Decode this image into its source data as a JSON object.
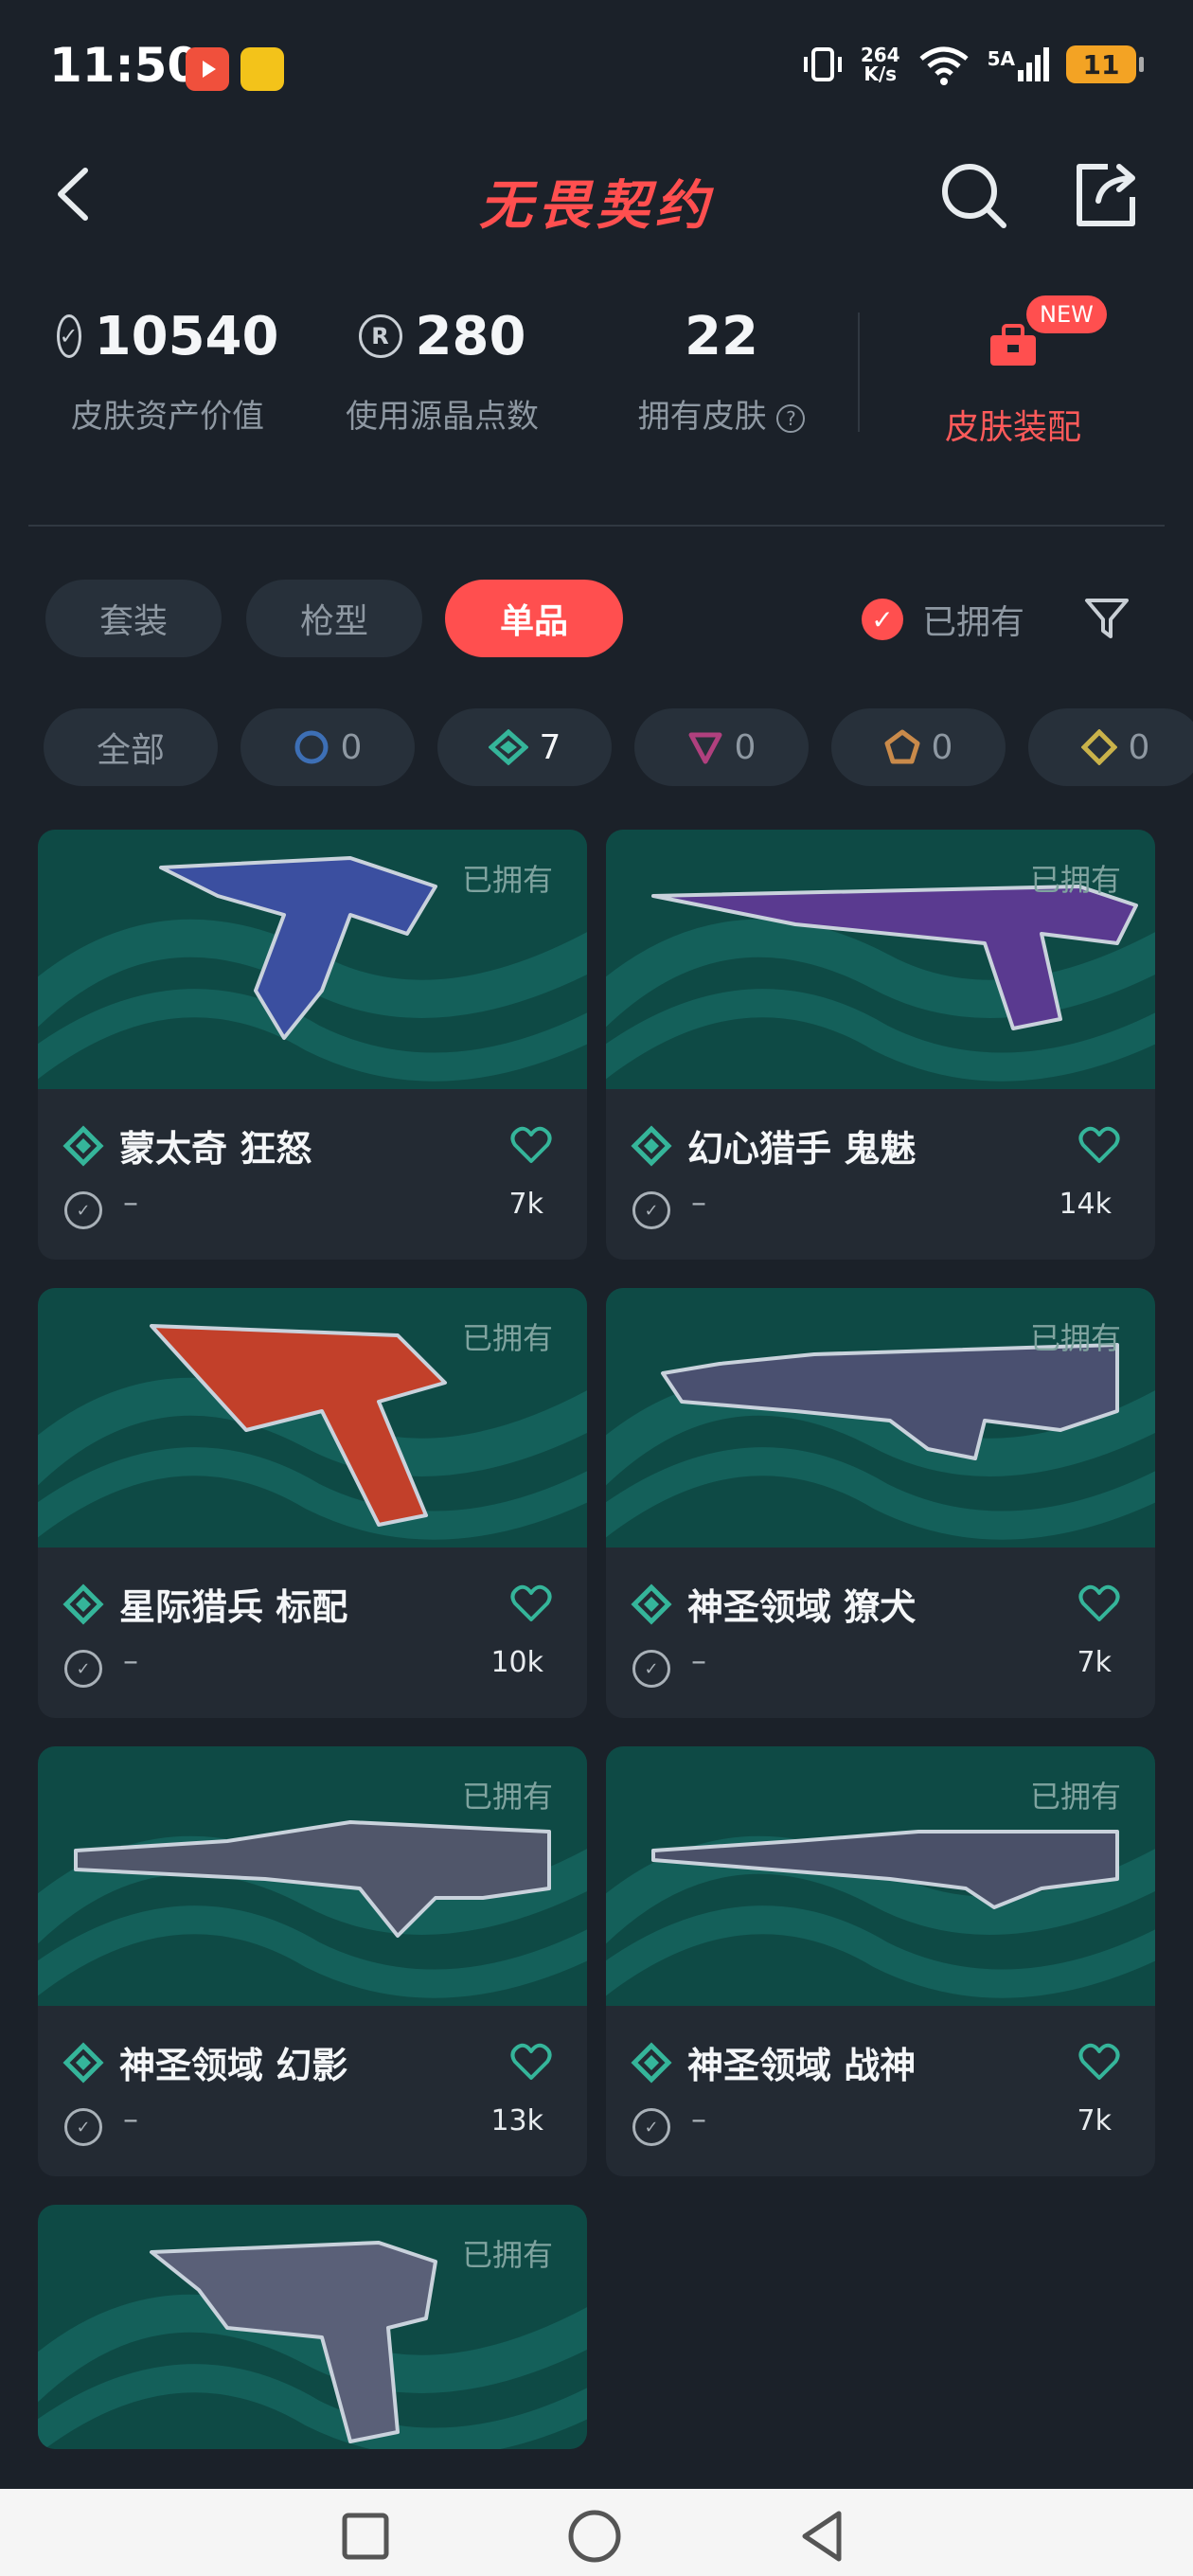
{
  "status_bar": {
    "time": "11:50",
    "net_speed_top": "264",
    "net_speed_bottom": "K/s",
    "signal": "5A",
    "battery": "11",
    "notif_icons": [
      "video-app-icon",
      "game-app-icon"
    ]
  },
  "header": {
    "title": "无畏契约",
    "icons": [
      "back-icon",
      "search-icon",
      "share-icon"
    ]
  },
  "stats": [
    {
      "value": "10540",
      "label": "皮肤资产价值",
      "icon": "vp-icon"
    },
    {
      "value": "280",
      "label": "使用源晶点数",
      "icon": "radianite-icon"
    },
    {
      "value": "22",
      "label": "拥有皮肤",
      "icon": "help-icon"
    }
  ],
  "equip": {
    "label": "皮肤装配",
    "badge": "NEW"
  },
  "tabs": [
    "套装",
    "枪型",
    "单品"
  ],
  "active_tab": "单品",
  "owned_filter": {
    "label": "已拥有",
    "checked": true
  },
  "chips": [
    {
      "label": "全部"
    },
    {
      "icon": "select-tier-icon",
      "count": "0",
      "color": "#3d6fb5"
    },
    {
      "icon": "deluxe-tier-icon",
      "count": "7",
      "color": "#35b59a"
    },
    {
      "icon": "premium-tier-icon",
      "count": "0",
      "color": "#b0407e"
    },
    {
      "icon": "exclusive-tier-icon",
      "count": "0",
      "color": "#c98a4a"
    },
    {
      "icon": "ultra-tier-icon",
      "count": "0",
      "color": "#c9b24a"
    }
  ],
  "cards": [
    {
      "name": "蒙太奇 狂怒",
      "owned": "已拥有",
      "price": "–",
      "likes": "7k"
    },
    {
      "name": "幻心猎手 鬼魅",
      "owned": "已拥有",
      "price": "–",
      "likes": "14k"
    },
    {
      "name": "星际猎兵 标配",
      "owned": "已拥有",
      "price": "–",
      "likes": "10k"
    },
    {
      "name": "神圣领域 獠犬",
      "owned": "已拥有",
      "price": "–",
      "likes": "7k"
    },
    {
      "name": "神圣领域 幻影",
      "owned": "已拥有",
      "price": "–",
      "likes": "13k"
    },
    {
      "name": "神圣领域 战神",
      "owned": "已拥有",
      "price": "–",
      "likes": "7k"
    },
    {
      "name": "",
      "owned": "已拥有",
      "price": "",
      "likes": ""
    }
  ],
  "colors": {
    "accent": "#ff4f4f",
    "background": "#1b2129",
    "card_art": "#0e4a45",
    "deluxe": "#35b59a"
  }
}
